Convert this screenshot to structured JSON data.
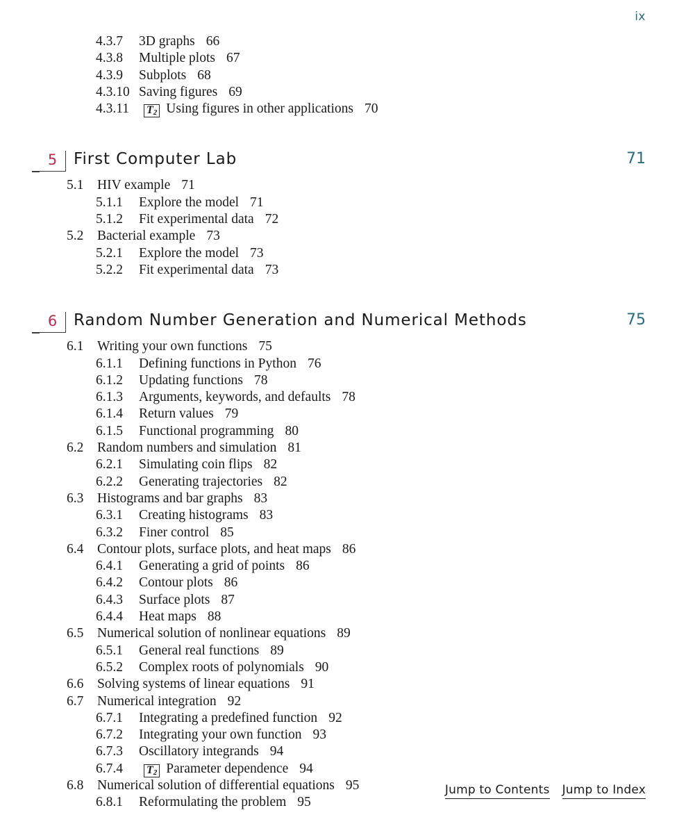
{
  "folio": "ix",
  "marker_icon": {
    "name": "t2-marker-icon",
    "letter": "T",
    "subscript": "2"
  },
  "colors": {
    "chapter_number": "#b33050",
    "page_number": "#2c6b7a",
    "text": "#1a1a1a"
  },
  "top_entries": [
    {
      "num": "4.3.7",
      "title": "3D graphs",
      "page": "66",
      "marker": false
    },
    {
      "num": "4.3.8",
      "title": "Multiple plots",
      "page": "67",
      "marker": false
    },
    {
      "num": "4.3.9",
      "title": "Subplots",
      "page": "68",
      "marker": false
    },
    {
      "num": "4.3.10",
      "title": "Saving figures",
      "page": "69",
      "marker": false
    },
    {
      "num": "4.3.11",
      "title": "Using figures in other applications",
      "page": "70",
      "marker": true
    }
  ],
  "chapters": [
    {
      "number": "5",
      "title": "First Computer Lab",
      "page": "71",
      "sections": [
        {
          "level": 2,
          "num": "5.1",
          "title": "HIV example",
          "page": "71",
          "marker": false
        },
        {
          "level": 3,
          "num": "5.1.1",
          "title": "Explore the model",
          "page": "71",
          "marker": false
        },
        {
          "level": 3,
          "num": "5.1.2",
          "title": "Fit experimental data",
          "page": "72",
          "marker": false
        },
        {
          "level": 2,
          "num": "5.2",
          "title": "Bacterial example",
          "page": "73",
          "marker": false
        },
        {
          "level": 3,
          "num": "5.2.1",
          "title": "Explore the model",
          "page": "73",
          "marker": false
        },
        {
          "level": 3,
          "num": "5.2.2",
          "title": "Fit experimental data",
          "page": "73",
          "marker": false
        }
      ]
    },
    {
      "number": "6",
      "title": "Random Number Generation and Numerical Methods",
      "page": "75",
      "sections": [
        {
          "level": 2,
          "num": "6.1",
          "title": "Writing your own functions",
          "page": "75",
          "marker": false
        },
        {
          "level": 3,
          "num": "6.1.1",
          "title": "Defining functions in Python",
          "page": "76",
          "marker": false
        },
        {
          "level": 3,
          "num": "6.1.2",
          "title": "Updating functions",
          "page": "78",
          "marker": false
        },
        {
          "level": 3,
          "num": "6.1.3",
          "title": "Arguments, keywords, and defaults",
          "page": "78",
          "marker": false
        },
        {
          "level": 3,
          "num": "6.1.4",
          "title": "Return values",
          "page": "79",
          "marker": false
        },
        {
          "level": 3,
          "num": "6.1.5",
          "title": "Functional programming",
          "page": "80",
          "marker": false
        },
        {
          "level": 2,
          "num": "6.2",
          "title": "Random numbers and simulation",
          "page": "81",
          "marker": false
        },
        {
          "level": 3,
          "num": "6.2.1",
          "title": "Simulating coin flips",
          "page": "82",
          "marker": false
        },
        {
          "level": 3,
          "num": "6.2.2",
          "title": "Generating trajectories",
          "page": "82",
          "marker": false
        },
        {
          "level": 2,
          "num": "6.3",
          "title": "Histograms and bar graphs",
          "page": "83",
          "marker": false
        },
        {
          "level": 3,
          "num": "6.3.1",
          "title": "Creating histograms",
          "page": "83",
          "marker": false
        },
        {
          "level": 3,
          "num": "6.3.2",
          "title": "Finer control",
          "page": "85",
          "marker": false
        },
        {
          "level": 2,
          "num": "6.4",
          "title": "Contour plots, surface plots, and heat maps",
          "page": "86",
          "marker": false
        },
        {
          "level": 3,
          "num": "6.4.1",
          "title": "Generating a grid of points",
          "page": "86",
          "marker": false
        },
        {
          "level": 3,
          "num": "6.4.2",
          "title": "Contour plots",
          "page": "86",
          "marker": false
        },
        {
          "level": 3,
          "num": "6.4.3",
          "title": "Surface plots",
          "page": "87",
          "marker": false
        },
        {
          "level": 3,
          "num": "6.4.4",
          "title": "Heat maps",
          "page": "88",
          "marker": false
        },
        {
          "level": 2,
          "num": "6.5",
          "title": "Numerical solution of nonlinear equations",
          "page": "89",
          "marker": false
        },
        {
          "level": 3,
          "num": "6.5.1",
          "title": "General real functions",
          "page": "89",
          "marker": false
        },
        {
          "level": 3,
          "num": "6.5.2",
          "title": "Complex roots of polynomials",
          "page": "90",
          "marker": false
        },
        {
          "level": 2,
          "num": "6.6",
          "title": "Solving systems of linear equations",
          "page": "91",
          "marker": false
        },
        {
          "level": 2,
          "num": "6.7",
          "title": "Numerical integration",
          "page": "92",
          "marker": false
        },
        {
          "level": 3,
          "num": "6.7.1",
          "title": "Integrating a predefined function",
          "page": "92",
          "marker": false
        },
        {
          "level": 3,
          "num": "6.7.2",
          "title": "Integrating your own function",
          "page": "93",
          "marker": false
        },
        {
          "level": 3,
          "num": "6.7.3",
          "title": "Oscillatory integrands",
          "page": "94",
          "marker": false
        },
        {
          "level": 3,
          "num": "6.7.4",
          "title": "Parameter dependence",
          "page": "94",
          "marker": true
        },
        {
          "level": 2,
          "num": "6.8",
          "title": "Numerical solution of differential equations",
          "page": "95",
          "marker": false
        },
        {
          "level": 3,
          "num": "6.8.1",
          "title": "Reformulating the problem",
          "page": "95",
          "marker": false
        }
      ]
    }
  ],
  "footer": {
    "contents_link": "Jump to Contents",
    "index_link": "Jump to Index"
  }
}
